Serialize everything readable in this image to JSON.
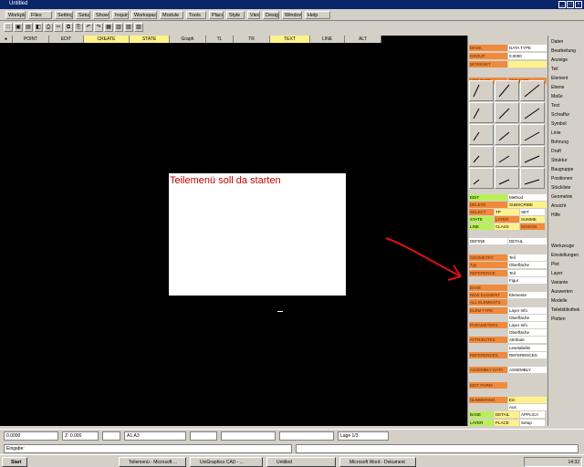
{
  "window": {
    "title": "Untitled"
  },
  "menubar": {
    "items": [
      "Workplane",
      "Files",
      "Settings",
      "Setup",
      "Show All",
      "Inquiry",
      "Workspace",
      "Module",
      "Tools",
      "Place",
      "Style",
      "View",
      "Design",
      "Window",
      "Help"
    ]
  },
  "grid": {
    "columns": [
      "POINT",
      "EDIT",
      "CREATE",
      "STATE",
      "Graph",
      "TL",
      "TR",
      "TEXT",
      "LINE",
      "ALT"
    ]
  },
  "dialog": {
    "message": "Teilemenü soll da starten"
  },
  "right_panel": {
    "top_rows": [
      [
        "MASK",
        "DATA TYPE"
      ],
      [
        "GROUP",
        "0.0000"
      ],
      [
        "WORKSET",
        ""
      ],
      [
        "",
        ""
      ],
      [
        "LINE TYPE",
        "SET TYPE"
      ]
    ],
    "mid_rows": [
      [
        "EDIT",
        "Method"
      ],
      [
        "DELETE",
        "SUBSCRIBE"
      ],
      [
        "SELECT",
        "TP",
        "SET"
      ],
      [
        "STATE",
        "LAYER",
        "SUMME"
      ],
      [
        "LINE",
        "CLASS",
        "DESIGN"
      ]
    ],
    "list_header": [
      "DEFINE",
      "DETAIL"
    ],
    "list_rows": [
      [
        "",
        ""
      ],
      [
        "GEOMETRY",
        "Teil"
      ],
      [
        "Typ",
        "Oberfläche"
      ],
      [
        "REFERENCE",
        "Teil"
      ],
      [
        "",
        "Figur"
      ],
      [
        "BASE",
        ""
      ],
      [
        "NEW ELEMENT",
        "Elemente"
      ],
      [
        "ALL ELEMENTS",
        ""
      ],
      [
        "ELEM TYPE",
        "Layer Info"
      ],
      [
        "",
        "Oberfläche"
      ],
      [
        "PARAMETERS",
        "Layer Info"
      ],
      [
        "",
        "Oberfläche"
      ],
      [
        "ATTRIBUTES",
        "Attribute"
      ],
      [
        "",
        "Lesetabelle"
      ],
      [
        "REFERENCES",
        "REFERENCES"
      ],
      [
        "",
        ""
      ],
      [
        "ASSEMBLY DATA",
        "ASSEMBLY"
      ],
      [
        "",
        ""
      ],
      [
        "EDIT FORM",
        ""
      ],
      [
        "",
        ""
      ],
      [
        "NUMBERING",
        "Ein"
      ],
      [
        "",
        "Aus"
      ],
      [
        "BASE",
        "DETAIL",
        "APPLICA"
      ],
      [
        "LAYER",
        "PLACE",
        "Setup"
      ]
    ]
  },
  "side_column": {
    "items": [
      "Daten",
      "Bearbeitung",
      "Anzeige",
      "Teil",
      "Element",
      "Ebene",
      "Maße",
      "Text",
      "Schraffur",
      "Symbol",
      "Linie",
      "Bohrung",
      "Draft",
      "Struktur",
      "Baugruppe",
      "Positionen",
      "Stückliste",
      "Geometrie",
      "Ansicht",
      "Hilfe",
      "Werkzeuge",
      "Einstellungen",
      "Plot",
      "Layer",
      "Variante",
      "Auswerten",
      "Modelle",
      "Teilebibliothek",
      "Plotten"
    ]
  },
  "statusbar": {
    "fields": [
      "0.0000",
      "Z: 0.000",
      "",
      "A1:A3",
      "",
      "",
      "",
      "Lage 1/3"
    ]
  },
  "cmdline": {
    "prompt": "Eingabe:"
  },
  "taskbar": {
    "start": "Start",
    "tasks": [
      "Teilemenü - Microsoft ...",
      "UniGraphics CAD - ...",
      "Untitled",
      "Microsoft Word - Dokument"
    ],
    "clock": "14:32"
  }
}
